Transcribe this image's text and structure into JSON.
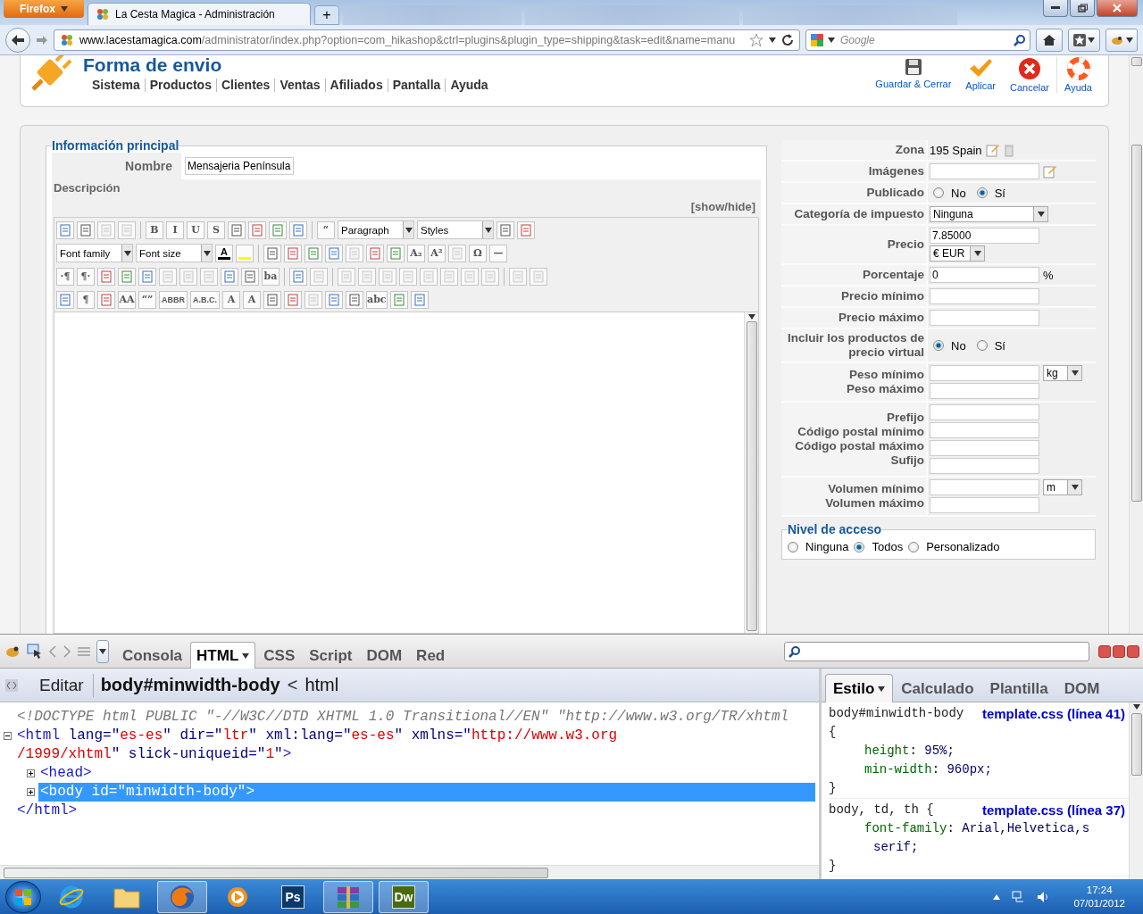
{
  "browser": {
    "app_button": "Firefox",
    "tabs": [
      {
        "title": "La Cesta Magica - Administración",
        "selected": true
      }
    ],
    "new_tab": "+",
    "url_domain": "www.lacestamagica.com",
    "url_path": "/administrator/index.php?option=com_hikashop&ctrl=plugins&plugin_type=shipping&task=edit&name=manu",
    "search": {
      "placeholder": "Google"
    }
  },
  "header": {
    "title": "Forma de envio",
    "menu": [
      "Sistema",
      "Productos",
      "Clientes",
      "Ventas",
      "Afiliados",
      "Pantalla",
      "Ayuda"
    ],
    "actions": [
      {
        "kind": "save",
        "label": "Guardar & Cerrar"
      },
      {
        "kind": "apply",
        "label": "Aplicar"
      },
      {
        "kind": "cancel",
        "label": "Cancelar"
      },
      {
        "kind": "help",
        "label": "Ayuda"
      }
    ]
  },
  "main": {
    "legend": "Información principal",
    "name_label": "Nombre",
    "name_value": "Mensajeria Península",
    "description_label": "Descripción",
    "toggle": "[show/hide]",
    "editor_rows": [
      [
        {
          "kind": "icon"
        },
        {
          "kind": "icon"
        },
        {
          "kind": "dim"
        },
        {
          "kind": "dim"
        },
        {
          "kind": "sep"
        },
        {
          "kind": "glyph",
          "text": "B"
        },
        {
          "kind": "glyph",
          "text": "I"
        },
        {
          "kind": "glyph",
          "text": "U"
        },
        {
          "kind": "glyph",
          "text": "S"
        },
        {
          "kind": "icon"
        },
        {
          "kind": "icon"
        },
        {
          "kind": "icon"
        },
        {
          "kind": "icon"
        },
        {
          "kind": "sep"
        },
        {
          "kind": "glyph",
          "text": "“"
        },
        {
          "kind": "select",
          "text": "Paragraph"
        },
        {
          "kind": "select",
          "text": "Styles"
        },
        {
          "kind": "icon"
        },
        {
          "kind": "icon"
        }
      ],
      [
        {
          "kind": "select",
          "text": "Font family"
        },
        {
          "kind": "select",
          "text": "Font size"
        },
        {
          "kind": "color",
          "text": "A",
          "color": "#000000"
        },
        {
          "kind": "color",
          "color": "#ffff00"
        },
        {
          "kind": "sep"
        },
        {
          "kind": "icon"
        },
        {
          "kind": "icon"
        },
        {
          "kind": "icon"
        },
        {
          "kind": "icon"
        },
        {
          "kind": "dim"
        },
        {
          "kind": "icon"
        },
        {
          "kind": "icon"
        },
        {
          "kind": "glyph",
          "text": "A₂"
        },
        {
          "kind": "glyph",
          "text": "A²"
        },
        {
          "kind": "dim"
        },
        {
          "kind": "glyph",
          "text": "Ω"
        },
        {
          "kind": "glyph",
          "text": "—"
        }
      ],
      [
        {
          "kind": "glyph",
          "text": "·¶"
        },
        {
          "kind": "glyph",
          "text": "¶·"
        },
        {
          "kind": "icon"
        },
        {
          "kind": "icon"
        },
        {
          "kind": "icon"
        },
        {
          "kind": "dim"
        },
        {
          "kind": "dim"
        },
        {
          "kind": "dim"
        },
        {
          "kind": "icon"
        },
        {
          "kind": "icon"
        },
        {
          "kind": "glyph",
          "text": "ba"
        },
        {
          "kind": "sep"
        },
        {
          "kind": "icon"
        },
        {
          "kind": "dim"
        },
        {
          "kind": "sep"
        },
        {
          "kind": "dim"
        },
        {
          "kind": "dim"
        },
        {
          "kind": "dim"
        },
        {
          "kind": "dim"
        },
        {
          "kind": "dim"
        },
        {
          "kind": "dim"
        },
        {
          "kind": "dim"
        },
        {
          "kind": "dim"
        },
        {
          "kind": "sep"
        },
        {
          "kind": "dim"
        },
        {
          "kind": "dim"
        }
      ],
      [
        {
          "kind": "icon"
        },
        {
          "kind": "glyph",
          "text": "¶"
        },
        {
          "kind": "icon"
        },
        {
          "kind": "glyph",
          "text": "AA"
        },
        {
          "kind": "glyph",
          "text": "“”"
        },
        {
          "kind": "glyph",
          "text": "ABBR"
        },
        {
          "kind": "glyph",
          "text": "A.B.C."
        },
        {
          "kind": "glyph",
          "text": "A"
        },
        {
          "kind": "glyph",
          "text": "A"
        },
        {
          "kind": "icon"
        },
        {
          "kind": "icon"
        },
        {
          "kind": "dim"
        },
        {
          "kind": "icon"
        },
        {
          "kind": "icon"
        },
        {
          "kind": "glyph",
          "text": "abc"
        },
        {
          "kind": "icon"
        },
        {
          "kind": "icon"
        }
      ]
    ]
  },
  "shipping": {
    "rows": [
      {
        "kind": "zone",
        "labels": [
          "Zona"
        ],
        "value": "195 Spain"
      },
      {
        "kind": "image",
        "labels": [
          "Imágenes"
        ]
      },
      {
        "kind": "radio",
        "labels": [
          "Publicado"
        ],
        "options": [
          {
            "label": "No",
            "selected": false
          },
          {
            "label": "Sí",
            "selected": true
          }
        ]
      },
      {
        "kind": "select",
        "labels": [
          "Categoría de impuesto"
        ],
        "value": "Ninguna"
      },
      {
        "kind": "price",
        "labels": [
          "Precio"
        ],
        "value": "7.85000",
        "currency": "€ EUR"
      },
      {
        "kind": "percent",
        "labels": [
          "Porcentaje"
        ],
        "value": "0",
        "unit": "%"
      },
      {
        "kind": "inputs",
        "labels": [
          "Precio mínimo"
        ]
      },
      {
        "kind": "inputs",
        "labels": [
          "Precio máximo"
        ]
      },
      {
        "kind": "radio",
        "labels": [
          "Incluir los productos de precio virtual"
        ],
        "options": [
          {
            "label": "No",
            "selected": true
          },
          {
            "label": "Sí",
            "selected": false
          }
        ]
      },
      {
        "kind": "inputs",
        "labels": [
          "Peso mínimo",
          "Peso máximo"
        ],
        "unit": "kg"
      },
      {
        "kind": "inputs",
        "labels": [
          "Prefijo",
          "Código postal mínimo",
          "Código postal máximo",
          "Sufijo"
        ]
      },
      {
        "kind": "inputs",
        "labels": [
          "Volumen mínimo",
          "Volumen máximo"
        ],
        "unit": "m"
      }
    ],
    "access": {
      "legend": "Nivel de acceso",
      "options": [
        {
          "label": "Ninguna",
          "selected": false
        },
        {
          "label": "Todos",
          "selected": true
        },
        {
          "label": "Personalizado",
          "selected": false
        }
      ]
    }
  },
  "devtools": {
    "tabs": [
      {
        "label": "Consola",
        "selected": false
      },
      {
        "label": "HTML",
        "selected": true
      },
      {
        "label": "CSS",
        "selected": false
      },
      {
        "label": "Script",
        "selected": false
      },
      {
        "label": "DOM",
        "selected": false
      },
      {
        "label": "Red",
        "selected": false
      }
    ],
    "edit_button": "Editar",
    "breadcrumb": [
      {
        "label": "body#minwidth-body",
        "selected": true
      },
      {
        "label": "html",
        "selected": false
      }
    ],
    "breadcrumb_separator": "<",
    "nodes": [
      {
        "kind": "doctype",
        "lines": [
          [
            {
              "kind": "comment",
              "text": "<!DOCTYPE html PUBLIC \"-//W3C//DTD XHTML 1.0 Transitional//EN\" \"http://www.w3.org/TR/xhtml"
            }
          ]
        ]
      },
      {
        "kind": "element",
        "expanded": true,
        "selected": false,
        "lines": [
          [
            {
              "kind": "tag",
              "text": "<html"
            },
            {
              "kind": "attr",
              "text": " lang=\""
            },
            {
              "kind": "value",
              "text": "es-es"
            },
            {
              "kind": "attr",
              "text": "\" dir=\""
            },
            {
              "kind": "value",
              "text": "ltr"
            },
            {
              "kind": "attr",
              "text": "\" xml:lang=\""
            },
            {
              "kind": "value",
              "text": "es-es"
            },
            {
              "kind": "attr",
              "text": "\" xmlns=\""
            },
            {
              "kind": "value",
              "text": "http://www.w3.org"
            }
          ],
          [
            {
              "kind": "value",
              "text": "/1999/xhtml"
            },
            {
              "kind": "attr",
              "text": "\" slick-uniqueid=\""
            },
            {
              "kind": "value",
              "text": "1"
            },
            {
              "kind": "attr",
              "text": "\""
            },
            {
              "kind": "tag",
              "text": ">"
            }
          ]
        ],
        "children": [
          {
            "kind": "element",
            "expanded": false,
            "selected": false,
            "lines": [
              [
                {
                  "kind": "tag",
                  "text": "<head>"
                }
              ]
            ]
          },
          {
            "kind": "element",
            "expanded": false,
            "selected": true,
            "lines": [
              [
                {
                  "kind": "tag",
                  "text": "<body"
                },
                {
                  "kind": "attr",
                  "text": " id=\""
                },
                {
                  "kind": "value",
                  "text": "minwidth-body"
                },
                {
                  "kind": "attr",
                  "text": "\""
                },
                {
                  "kind": "tag",
                  "text": ">"
                }
              ]
            ]
          }
        ],
        "close": [
          {
            "kind": "tag",
            "text": "</html>"
          }
        ]
      }
    ],
    "side_tabs": [
      {
        "label": "Estilo",
        "selected": true
      },
      {
        "label": "Calculado",
        "selected": false
      },
      {
        "label": "Plantilla",
        "selected": false
      },
      {
        "label": "DOM",
        "selected": false
      }
    ],
    "property_separator": ":",
    "rules": [
      {
        "selector_lines": [
          "body#minwidth-body",
          "{"
        ],
        "source": "template.css (línea 41)",
        "properties": [
          {
            "name": "height",
            "value_lines": [
              "95%;"
            ]
          },
          {
            "name": "min-width",
            "value_lines": [
              "960px;"
            ]
          }
        ],
        "close": "}"
      },
      {
        "selector_lines": [
          "body, td, th {"
        ],
        "source": "template.css (línea 37)",
        "properties": [
          {
            "name": "font-family",
            "value_lines": [
              "Arial,Helvetica,s",
              "serif;"
            ]
          }
        ],
        "close": "}"
      }
    ]
  },
  "taskbar": {
    "apps": [
      {
        "kind": "ie",
        "active": false
      },
      {
        "kind": "folder",
        "active": false
      },
      {
        "kind": "firefox",
        "active": true
      },
      {
        "kind": "media",
        "active": false
      },
      {
        "kind": "text",
        "label": "Ps",
        "color": "#0a3a6a",
        "active": false
      },
      {
        "kind": "archive",
        "active": true
      },
      {
        "kind": "text",
        "label": "Dw",
        "color": "#4a6a10",
        "active": true
      }
    ],
    "time": "17:24",
    "date": "07/01/2012"
  }
}
